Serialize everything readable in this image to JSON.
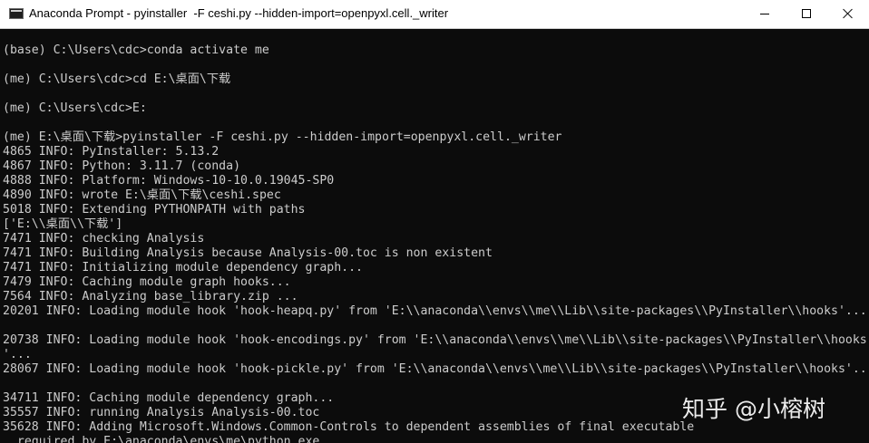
{
  "window": {
    "title": "Anaconda Prompt - pyinstaller  -F ceshi.py --hidden-import=openpyxl.cell._writer",
    "icon": "console-icon",
    "controls": {
      "minimize": "minimize-icon",
      "maximize": "maximize-icon",
      "close": "close-icon"
    }
  },
  "console": {
    "background": "#0c0c0c",
    "text_color": "#cccccc",
    "lines": [
      "(base) C:\\Users\\cdc>conda activate me",
      "",
      "(me) C:\\Users\\cdc>cd E:\\桌面\\下载",
      "",
      "(me) C:\\Users\\cdc>E:",
      "",
      "(me) E:\\桌面\\下载>pyinstaller -F ceshi.py --hidden-import=openpyxl.cell._writer",
      "4865 INFO: PyInstaller: 5.13.2",
      "4867 INFO: Python: 3.11.7 (conda)",
      "4888 INFO: Platform: Windows-10-10.0.19045-SP0",
      "4890 INFO: wrote E:\\桌面\\下载\\ceshi.spec",
      "5018 INFO: Extending PYTHONPATH with paths",
      "['E:\\\\桌面\\\\下载']",
      "7471 INFO: checking Analysis",
      "7471 INFO: Building Analysis because Analysis-00.toc is non existent",
      "7471 INFO: Initializing module dependency graph...",
      "7479 INFO: Caching module graph hooks...",
      "7564 INFO: Analyzing base_library.zip ...",
      "20201 INFO: Loading module hook 'hook-heapq.py' from 'E:\\\\anaconda\\\\envs\\\\me\\\\Lib\\\\site-packages\\\\PyInstaller\\\\hooks'...",
      "",
      "20738 INFO: Loading module hook 'hook-encodings.py' from 'E:\\\\anaconda\\\\envs\\\\me\\\\Lib\\\\site-packages\\\\PyInstaller\\\\hooks",
      "'...",
      "28067 INFO: Loading module hook 'hook-pickle.py' from 'E:\\\\anaconda\\\\envs\\\\me\\\\Lib\\\\site-packages\\\\PyInstaller\\\\hooks'...",
      "",
      "34711 INFO: Caching module dependency graph...",
      "35557 INFO: running Analysis Analysis-00.toc",
      "35628 INFO: Adding Microsoft.Windows.Common-Controls to dependent assemblies of final executable",
      "  required by E:\\anaconda\\envs\\me\\python.exe"
    ]
  },
  "watermark": {
    "text": "知乎 @小榕树"
  }
}
